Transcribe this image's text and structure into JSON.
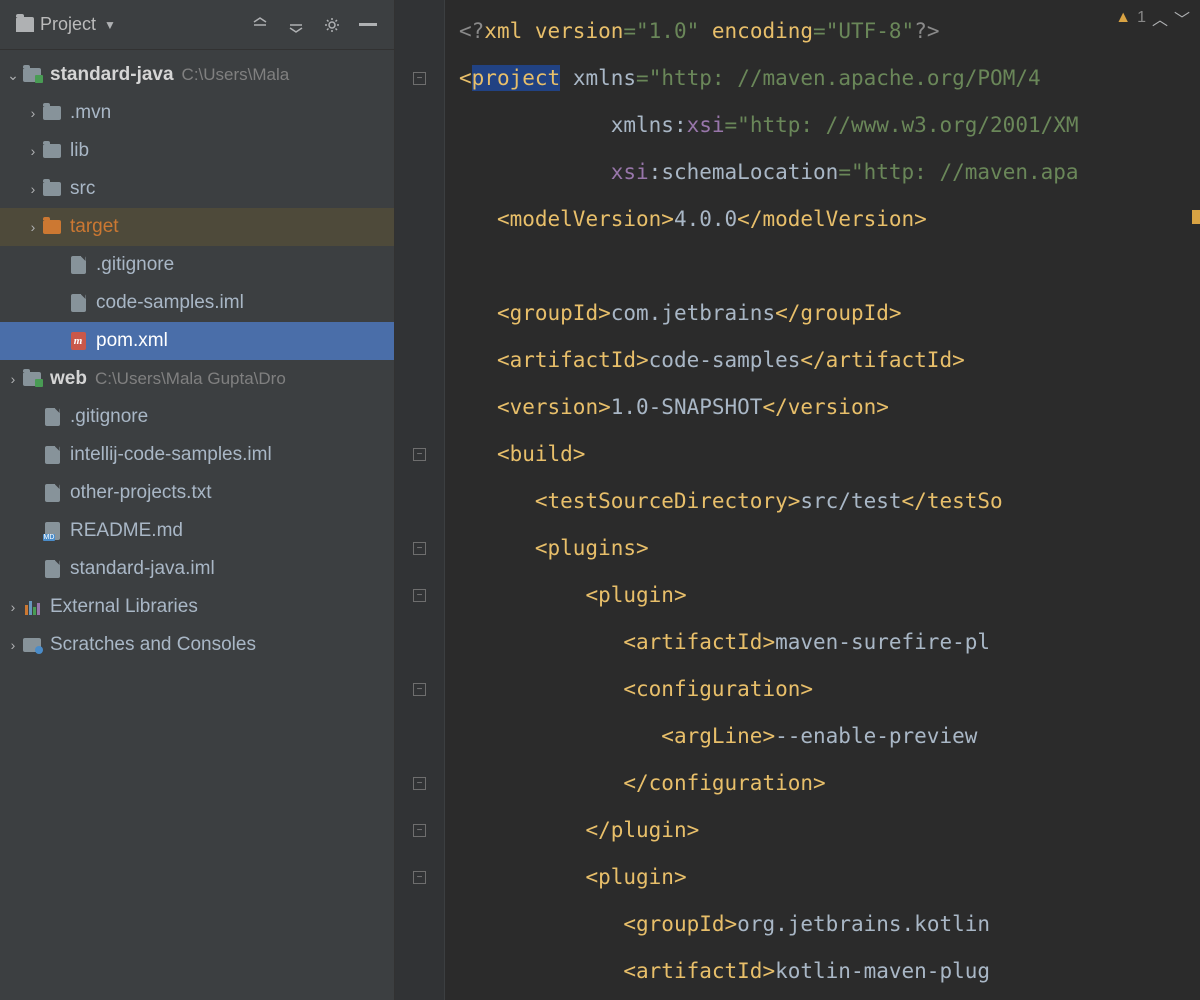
{
  "sidebar": {
    "title": "Project",
    "toolbar": {
      "collapse": "⇤",
      "expand": "⇥",
      "settings": "⚙",
      "hide": "—"
    },
    "tree": [
      {
        "id": "standard-java",
        "label": "standard-java",
        "path": "C:\\Users\\Mala",
        "indent": 0,
        "arrow": "down",
        "icon": "module",
        "bold": true
      },
      {
        "id": "mvn",
        "label": ".mvn",
        "indent": 1,
        "arrow": "right",
        "icon": "folder"
      },
      {
        "id": "lib",
        "label": "lib",
        "indent": 1,
        "arrow": "right",
        "icon": "folder"
      },
      {
        "id": "src",
        "label": "src",
        "indent": 1,
        "arrow": "right",
        "icon": "folder"
      },
      {
        "id": "target",
        "label": "target",
        "indent": 1,
        "arrow": "right",
        "icon": "folder-orange",
        "class": "highlighted orange-text"
      },
      {
        "id": "gitignore1",
        "label": ".gitignore",
        "indent": 2,
        "arrow": "none",
        "icon": "file"
      },
      {
        "id": "code-samples-iml",
        "label": "code-samples.iml",
        "indent": 2,
        "arrow": "none",
        "icon": "file"
      },
      {
        "id": "pom",
        "label": "pom.xml",
        "indent": 2,
        "arrow": "none",
        "icon": "xml",
        "class": "selected"
      },
      {
        "id": "web",
        "label": "web",
        "path": "C:\\Users\\Mala Gupta\\Dro",
        "indent": 0,
        "arrow": "right",
        "icon": "module",
        "bold": true
      },
      {
        "id": "gitignore2",
        "label": ".gitignore",
        "indent": 1,
        "arrow": "none",
        "icon": "file"
      },
      {
        "id": "intellij-iml",
        "label": "intellij-code-samples.iml",
        "indent": 1,
        "arrow": "none",
        "icon": "file"
      },
      {
        "id": "other-projects",
        "label": "other-projects.txt",
        "indent": 1,
        "arrow": "none",
        "icon": "file"
      },
      {
        "id": "readme",
        "label": "README.md",
        "indent": 1,
        "arrow": "none",
        "icon": "md"
      },
      {
        "id": "standard-java-iml",
        "label": "standard-java.iml",
        "indent": 1,
        "arrow": "none",
        "icon": "file"
      },
      {
        "id": "ext-lib",
        "label": "External Libraries",
        "indent": 0,
        "arrow": "right",
        "icon": "libs"
      },
      {
        "id": "scratches",
        "label": "Scratches and Consoles",
        "indent": 0,
        "arrow": "right",
        "icon": "scratch"
      }
    ]
  },
  "editor": {
    "warning_count": "1",
    "lines": [
      {
        "fold": "",
        "html": "<span class='t-prolog'>&lt;?</span><span class='t-tag'>xml version</span><span class='t-val'>=\"1.0\" </span><span class='t-tag'>encoding</span><span class='t-val'>=\"UTF-8\"</span><span class='t-prolog'>?&gt;</span>"
      },
      {
        "fold": "-",
        "html": "<span class='t-tag'>&lt;<span class='hl-project'>project</span> </span><span class='t-attr'>xmlns</span><span class='t-val'>=\"http: //maven.apache.org/POM/4</span>"
      },
      {
        "fold": "",
        "html": "            <span class='t-attr'>xmlns</span><span class='t-text'>:</span><span class='t-ns'>xsi</span><span class='t-val'>=\"http: //www.w3.org/2001/XM</span>"
      },
      {
        "fold": "",
        "html": "            <span class='t-ns'>xsi</span><span class='t-text'>:</span><span class='t-attr'>schemaLocation</span><span class='t-val'>=\"http: //maven.apa</span>"
      },
      {
        "fold": "",
        "html": "   <span class='t-tag'>&lt;modelVersion&gt;</span><span class='t-text'>4.0.0</span><span class='t-tag'>&lt;/modelVersion&gt;</span>"
      },
      {
        "fold": "",
        "html": ""
      },
      {
        "fold": "",
        "html": "   <span class='t-tag'>&lt;groupId&gt;</span><span class='t-text'>com.jetbrains</span><span class='t-tag'>&lt;/groupId&gt;</span>"
      },
      {
        "fold": "",
        "html": "   <span class='t-tag'>&lt;artifactId&gt;</span><span class='t-text'>code-samples</span><span class='t-tag'>&lt;/artifactId&gt;</span>"
      },
      {
        "fold": "",
        "html": "   <span class='t-tag'>&lt;version&gt;</span><span class='t-text'>1.0-SNAPSHOT</span><span class='t-tag'>&lt;/version&gt;</span>"
      },
      {
        "fold": "-",
        "html": "   <span class='t-tag'>&lt;build&gt;</span>"
      },
      {
        "fold": "",
        "html": "      <span class='t-tag'>&lt;testSourceDirectory&gt;</span><span class='t-text'>src/test</span><span class='t-tag'>&lt;/testSo</span>"
      },
      {
        "fold": "-",
        "html": "      <span class='t-tag'>&lt;plugins&gt;</span>"
      },
      {
        "fold": "-",
        "html": "          <span class='t-tag'>&lt;plugin&gt;</span>"
      },
      {
        "fold": "",
        "html": "             <span class='t-tag'>&lt;artifactId&gt;</span><span class='t-text'>maven-surefire-pl</span>"
      },
      {
        "fold": "-",
        "html": "             <span class='t-tag'>&lt;configuration&gt;</span>"
      },
      {
        "fold": "",
        "html": "                <span class='t-tag'>&lt;argLine&gt;</span><span class='t-text'>--enable-preview</span>"
      },
      {
        "fold": "-",
        "html": "             <span class='t-tag'>&lt;/configuration&gt;</span>"
      },
      {
        "fold": "-",
        "html": "          <span class='t-tag'>&lt;/plugin&gt;</span>"
      },
      {
        "fold": "-",
        "html": "          <span class='t-tag'>&lt;plugin&gt;</span>"
      },
      {
        "fold": "",
        "html": "             <span class='t-tag'>&lt;groupId&gt;</span><span class='t-text'>org.jetbrains.kotlin</span>"
      },
      {
        "fold": "",
        "html": "             <span class='t-tag'>&lt;artifactId&gt;</span><span class='t-text'>kotlin-maven-plug</span>"
      }
    ]
  }
}
